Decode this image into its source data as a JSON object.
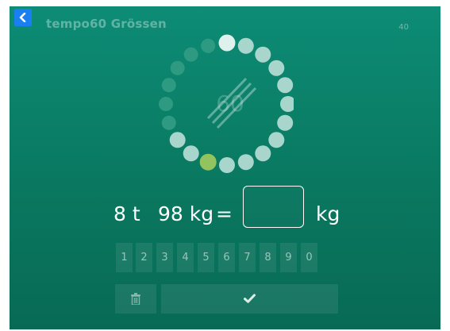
{
  "header": {
    "title": "tempo60 Grössen",
    "counter": "40"
  },
  "timer": {
    "label": "60",
    "dot_count": 20,
    "colors": {
      "bright": "#dff1ec",
      "mid": "#a9d6cc",
      "dim": "#2e9a82",
      "active": "#92c35e"
    }
  },
  "equation": {
    "value_tons": "8 t",
    "value_kg": "98 kg",
    "equals": "=",
    "answer": "",
    "unit": "kg"
  },
  "keypad": {
    "keys": [
      "1",
      "2",
      "3",
      "4",
      "5",
      "6",
      "7",
      "8",
      "9",
      "0"
    ]
  },
  "actions": {
    "delete_icon": "trash-icon",
    "confirm_icon": "checkmark-icon"
  },
  "colors": {
    "background_top": "#0d8c76",
    "background_bottom": "#086a55",
    "back_button": "#1a7ff0"
  }
}
